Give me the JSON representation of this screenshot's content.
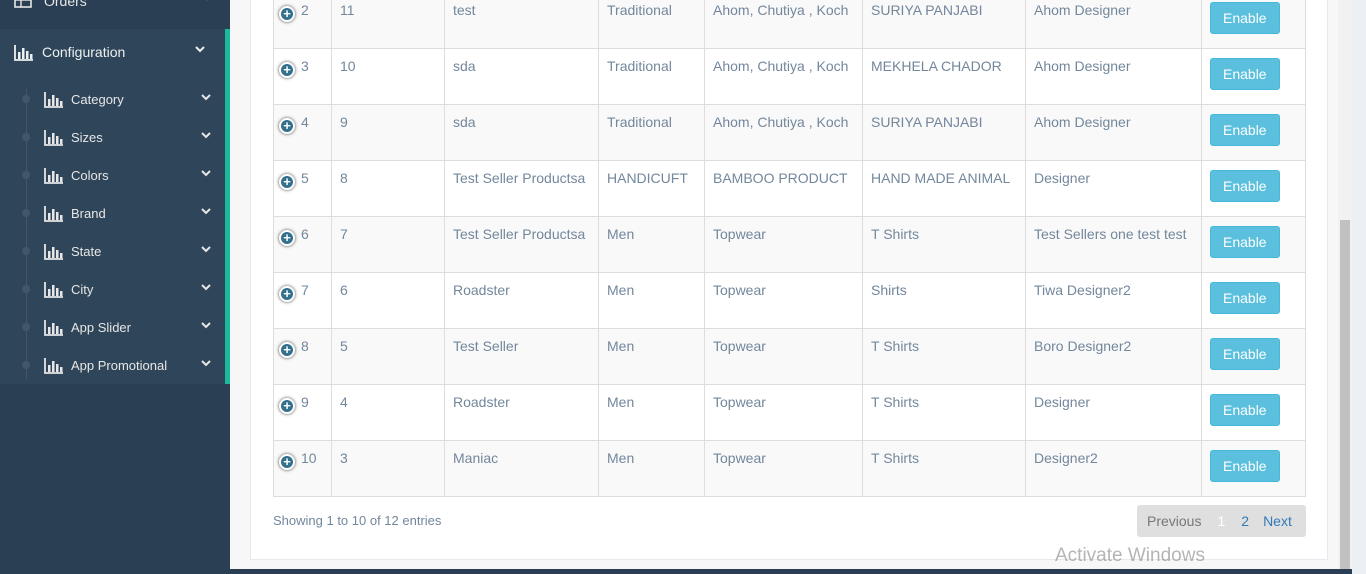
{
  "sidebar": {
    "top_item": {
      "label": "Orders"
    },
    "config": {
      "label": "Configuration"
    },
    "items": [
      {
        "label": "Category"
      },
      {
        "label": "Sizes"
      },
      {
        "label": "Colors"
      },
      {
        "label": "Brand"
      },
      {
        "label": "State"
      },
      {
        "label": "City"
      },
      {
        "label": "App Slider"
      },
      {
        "label": "App Promotional"
      }
    ]
  },
  "table": {
    "rows": [
      {
        "idx": "2",
        "id": "11",
        "name": "test",
        "category": "Traditional",
        "subcategory": "Ahom, Chutiya , Koch",
        "type": "SURIYA PANJABI",
        "designer": "Ahom Designer",
        "action": "Enable"
      },
      {
        "idx": "3",
        "id": "10",
        "name": "sda",
        "category": "Traditional",
        "subcategory": "Ahom, Chutiya , Koch",
        "type": "MEKHELA CHADOR",
        "designer": "Ahom Designer",
        "action": "Enable"
      },
      {
        "idx": "4",
        "id": "9",
        "name": "sda",
        "category": "Traditional",
        "subcategory": "Ahom, Chutiya , Koch",
        "type": "SURIYA PANJABI",
        "designer": "Ahom Designer",
        "action": "Enable"
      },
      {
        "idx": "5",
        "id": "8",
        "name": "Test Seller Productsa",
        "category": "HANDICUFT",
        "subcategory": "BAMBOO PRODUCT",
        "type": "HAND MADE ANIMAL",
        "designer": "Designer",
        "action": "Enable"
      },
      {
        "idx": "6",
        "id": "7",
        "name": "Test Seller Productsa",
        "category": "Men",
        "subcategory": "Topwear",
        "type": "T Shirts",
        "designer": "Test Sellers one test test",
        "action": "Enable"
      },
      {
        "idx": "7",
        "id": "6",
        "name": "Roadster",
        "category": "Men",
        "subcategory": "Topwear",
        "type": "Shirts",
        "designer": "Tiwa Designer2",
        "action": "Enable"
      },
      {
        "idx": "8",
        "id": "5",
        "name": "Test Seller",
        "category": "Men",
        "subcategory": "Topwear",
        "type": "T Shirts",
        "designer": "Boro Designer2",
        "action": "Enable"
      },
      {
        "idx": "9",
        "id": "4",
        "name": "Roadster",
        "category": "Men",
        "subcategory": "Topwear",
        "type": "T Shirts",
        "designer": "Designer",
        "action": "Enable"
      },
      {
        "idx": "10",
        "id": "3",
        "name": "Maniac",
        "category": "Men",
        "subcategory": "Topwear",
        "type": "T Shirts",
        "designer": "Designer2",
        "action": "Enable"
      }
    ]
  },
  "info": {
    "text": "Showing 1 to 10 of 12 entries"
  },
  "pagination": {
    "previous": "Previous",
    "page1": "1",
    "page2": "2",
    "next": "Next"
  },
  "watermark": {
    "text": "Activate Windows"
  },
  "colors": {
    "sidebar": "#2a3f54",
    "accent": "#1abb9c",
    "button": "#5bc0de",
    "link": "#337ab7"
  }
}
